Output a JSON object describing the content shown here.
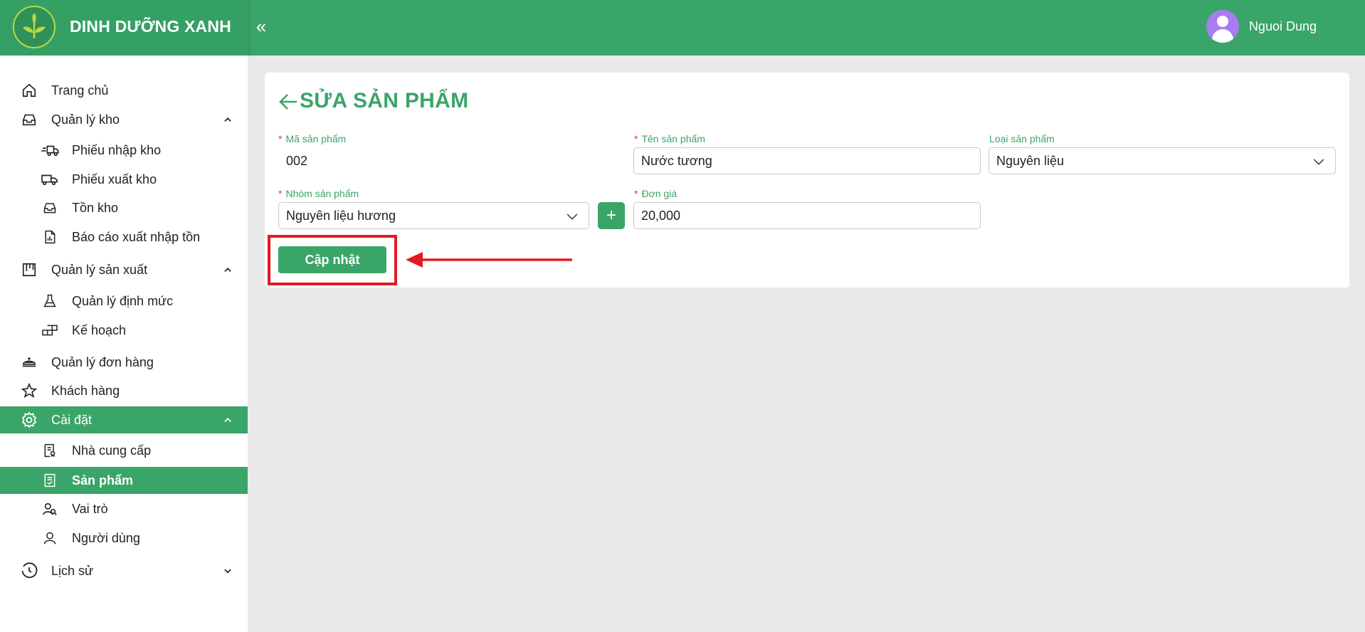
{
  "header": {
    "brand_name": "DINH DƯỠNG XANH",
    "collapse_icon": "«",
    "user_name": "Nguoi Dung"
  },
  "sidebar": {
    "items": [
      {
        "label": "Trang chủ",
        "icon": "home-icon"
      },
      {
        "label": "Quản lý kho",
        "icon": "inbox-icon",
        "expanded": true
      },
      {
        "label": "Phiếu nhập kho",
        "icon": "truck-in-icon"
      },
      {
        "label": "Phiếu xuất kho",
        "icon": "truck-out-icon"
      },
      {
        "label": "Tồn kho",
        "icon": "inbox-icon"
      },
      {
        "label": "Báo cáo xuất nhập tồn",
        "icon": "report-icon"
      },
      {
        "label": "Quản lý sản xuất",
        "icon": "board-icon",
        "expanded": true
      },
      {
        "label": "Quản lý định mức",
        "icon": "flask-icon"
      },
      {
        "label": "Kế hoạch",
        "icon": "blocks-icon"
      },
      {
        "label": "Quản lý đơn hàng",
        "icon": "dish-icon"
      },
      {
        "label": "Khách hàng",
        "icon": "star-icon"
      },
      {
        "label": "Cài đặt",
        "icon": "gear-icon",
        "expanded": true,
        "active": true
      },
      {
        "label": "Nhà cung cấp",
        "icon": "supplier-icon"
      },
      {
        "label": "Sản phẩm",
        "icon": "product-icon",
        "active": true
      },
      {
        "label": "Vai trò",
        "icon": "users-icon"
      },
      {
        "label": "Người dùng",
        "icon": "user-icon"
      },
      {
        "label": "Lịch sử",
        "icon": "clock-icon",
        "expanded": false
      }
    ]
  },
  "main": {
    "title": "SỬA SẢN PHẨM",
    "fields": {
      "product_code": {
        "label": "Mã sản phẩm",
        "value": "002",
        "required": true
      },
      "product_name": {
        "label": "Tên sản phẩm",
        "value": "Nước tương",
        "required": true
      },
      "product_type": {
        "label": "Loại sản phẩm",
        "value": "Nguyên liệu",
        "required": false
      },
      "product_group": {
        "label": "Nhóm sản phẩm",
        "value": "Nguyên liệu hương",
        "required": true
      },
      "unit_price": {
        "label": "Đơn giá",
        "value": "20,000",
        "required": true
      }
    },
    "required_mark": "*",
    "add_group_label": "+",
    "update_label": "Cập nhật"
  },
  "colors": {
    "brand": "#3aa569",
    "highlight": "#e01b24",
    "avatar": "#a97df0"
  }
}
